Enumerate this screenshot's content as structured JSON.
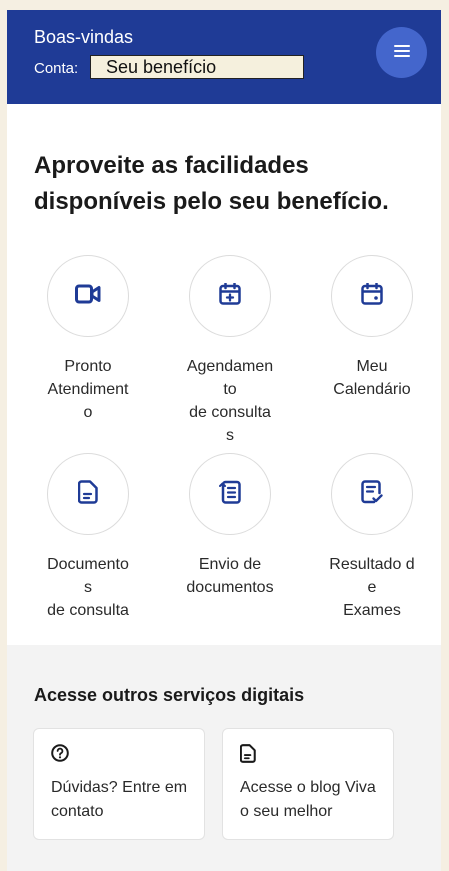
{
  "header": {
    "welcome": "Boas-vindas",
    "account_label": "Conta:",
    "account_value": "Seu benefício",
    "menu_icon": "hamburger-menu-icon"
  },
  "hero_title": "Aproveite as facilidades disponíveis pelo seu benefício.",
  "services": [
    {
      "label": "Pronto\nAtendimento",
      "icon": "video-camera-icon"
    },
    {
      "label": "Agendamento\nde consultas",
      "icon": "calendar-add-icon"
    },
    {
      "label": "Meu\nCalendário",
      "icon": "calendar-icon"
    },
    {
      "label": "Documentos\nde consulta",
      "icon": "document-icon"
    },
    {
      "label": "Envio de\ndocumentos",
      "icon": "upload-list-icon"
    },
    {
      "label": "Resultado de\nExames",
      "icon": "exam-result-icon"
    }
  ],
  "other_services": {
    "title": "Acesse outros serviços digitais",
    "cards": [
      {
        "text": "Dúvidas? Entre em contato",
        "icon": "question-circle-icon"
      },
      {
        "text": "Acesse o blog Viva o seu melhor",
        "icon": "document-icon"
      }
    ]
  },
  "colors": {
    "header_bg": "#1f3b96",
    "menu_button_bg": "#4466cc",
    "icon_blue": "#1f3b96"
  }
}
